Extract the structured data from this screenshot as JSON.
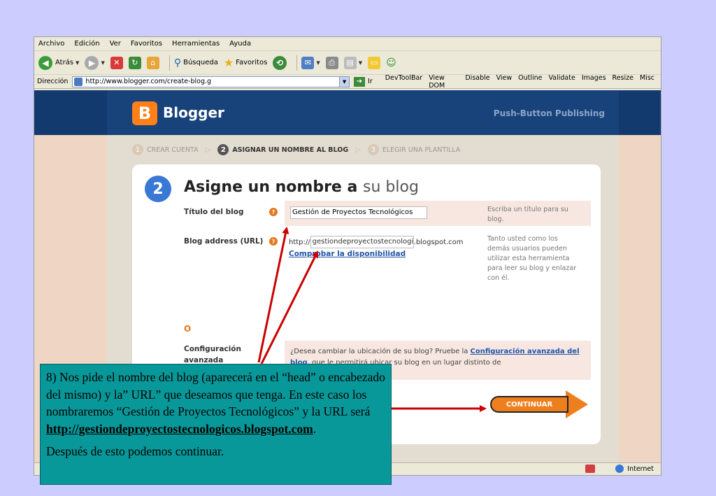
{
  "menu": [
    "Archivo",
    "Edición",
    "Ver",
    "Favoritos",
    "Herramientas",
    "Ayuda"
  ],
  "toolbar": {
    "back": "Atrás",
    "search": "Búsqueda",
    "favorites": "Favoritos"
  },
  "addressbar": {
    "label": "Dirección",
    "url": "http://www.blogger.com/create-blog.g",
    "go": "Ir",
    "devtools": [
      "DevToolBar",
      "View DOM",
      "Disable",
      "View",
      "Outline",
      "Validate",
      "Images",
      "Resize",
      "Misc"
    ]
  },
  "blogger": {
    "logo_letter": "B",
    "name": "Blogger",
    "tagline": "Push-Button Publishing",
    "steps": [
      {
        "num": "1",
        "label": "CREAR CUENTA"
      },
      {
        "num": "2",
        "label": "ASIGNAR UN NOMBRE AL BLOG"
      },
      {
        "num": "3",
        "label": "ELEGIR UNA PLANTILLA"
      }
    ],
    "step_number": "2",
    "heading_bold": "Asigne un nombre a",
    "heading_light": "su blog",
    "title_label": "Título del blog",
    "title_value": "Gestión de Proyectos Tecnológicos",
    "title_hint": "Escriba un título para su blog.",
    "address_label": "Blog address (URL)",
    "address_prefix": "http://",
    "address_value": "gestiondeproyectostecnologicos",
    "address_suffix": ".blogspot.com",
    "check_link": "Comprobar la disponibilidad",
    "address_hint": "Tanto usted como los demás usuarios pueden utilizar esta herramienta para leer su blog y enlazar con él.",
    "or_label": "O",
    "advanced_label": "Configuración avanzada",
    "advanced_text_pre": "¿Desea cambiar la ubicación de su blog? Pruebe la ",
    "advanced_link": "Configuración avanzada del blog",
    "advanced_text_post": ", que le permitirá ubicar su blog en un lugar distinto de",
    "continue_label": "CONTINUAR"
  },
  "status": {
    "zone": "Internet"
  },
  "annotation": {
    "text": "8) Nos pide el nombre del blog (aparecerá en el “head” o encabezado del mismo) y la” URL” que deseamos que tenga. En este caso los nombraremos “Gestión de Proyectos Tecnológicos” y la URL será ",
    "url": "http://gestiondeproyectostecnologicos.blogspot.com",
    "url_tail": ".",
    "text2": "Después de esto podemos continuar."
  },
  "colors": {
    "background": "#ccccff",
    "annotation_bg": "#08989a",
    "arrow": "#cc0000",
    "blogger_orange": "#ee7f1e",
    "header_blue": "#17427a"
  }
}
